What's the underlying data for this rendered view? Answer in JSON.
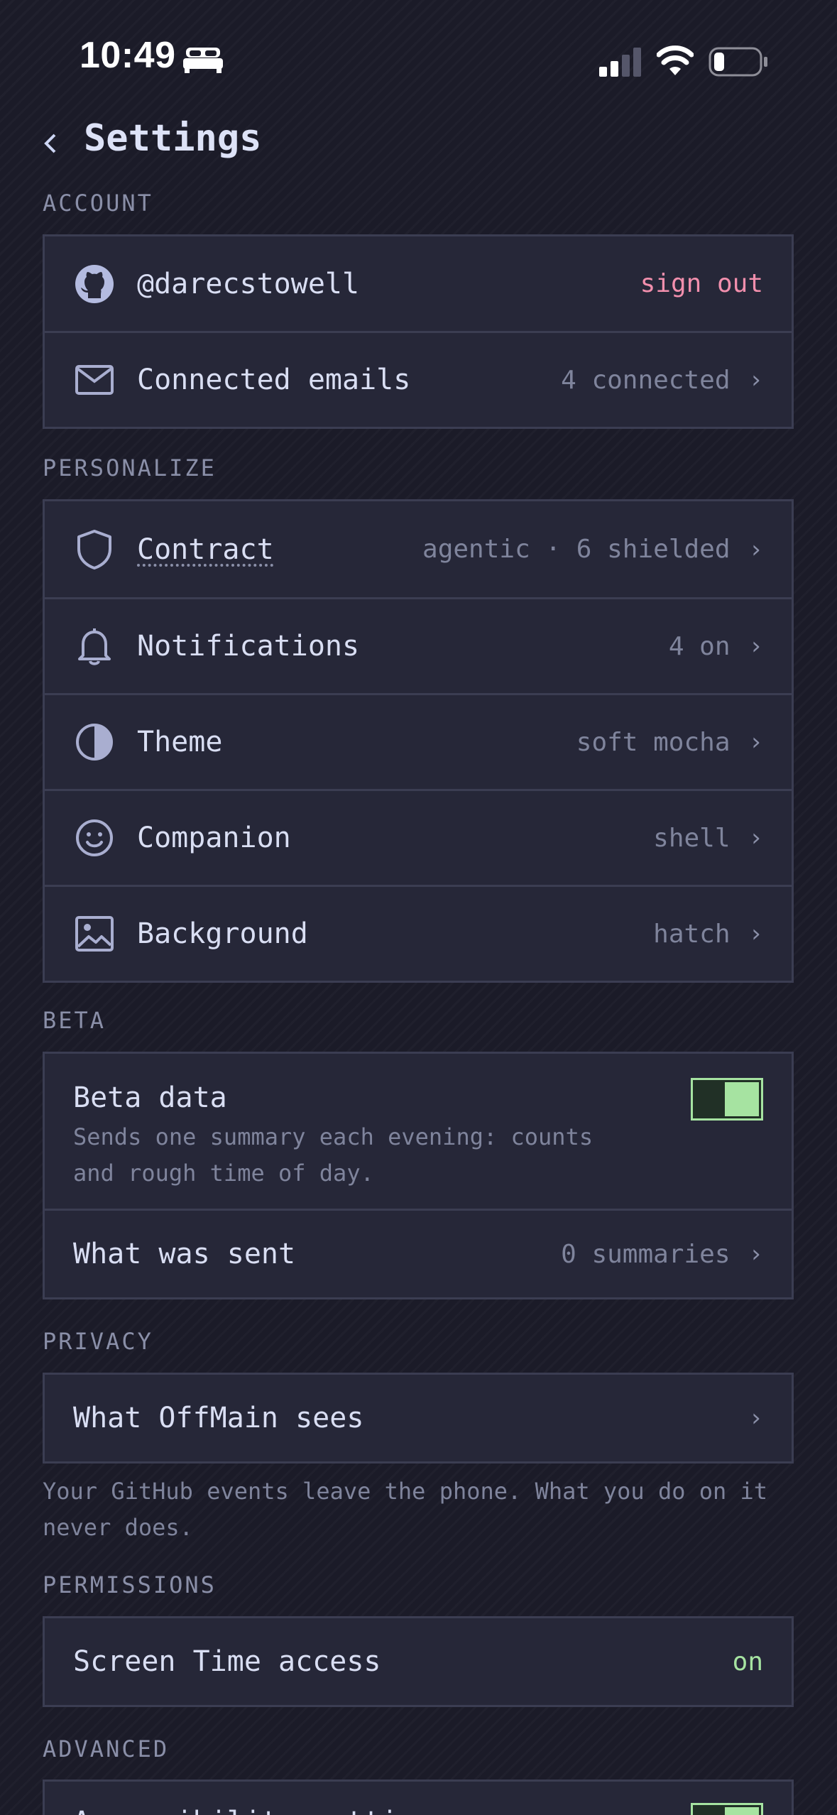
{
  "status_bar": {
    "time": "10:49"
  },
  "header": {
    "title": "Settings"
  },
  "sections": {
    "account": {
      "label": "ACCOUNT",
      "github": {
        "label": "@darecstowell",
        "action": "sign out",
        "icon": "github-icon"
      },
      "emails": {
        "label": "Connected emails",
        "value": "4 connected",
        "icon": "mail-icon"
      }
    },
    "personalize": {
      "label": "PERSONALIZE",
      "items": [
        {
          "label": "Contract",
          "value": "agentic · 6 shielded",
          "icon": "shield-icon"
        },
        {
          "label": "Notifications",
          "value": "4 on",
          "icon": "bell-icon"
        },
        {
          "label": "Theme",
          "value": "soft mocha",
          "icon": "contrast-icon"
        },
        {
          "label": "Companion",
          "value": "shell",
          "icon": "smiley-icon"
        },
        {
          "label": "Background",
          "value": "hatch",
          "icon": "image-icon"
        }
      ]
    },
    "beta": {
      "label": "BETA",
      "beta_data": {
        "label": "Beta data",
        "description": "Sends one summary each evening: counts and rough time of day.",
        "enabled": true
      },
      "what_sent": {
        "label": "What was sent",
        "value": "0 summaries"
      }
    },
    "privacy": {
      "label": "PRIVACY",
      "item": {
        "label": "What OffMain sees"
      },
      "footnote": "Your GitHub events leave the phone. What you do on it never does."
    },
    "permissions": {
      "label": "PERMISSIONS",
      "screen_time": {
        "label": "Screen Time access",
        "value": "on"
      }
    },
    "advanced": {
      "label": "ADVANCED",
      "item": {
        "label": "Accessibility settings",
        "enabled": true
      }
    }
  },
  "chevron": "›",
  "colors": {
    "background": "#1b1b28",
    "card": "#262738",
    "border": "#3b3d52",
    "text": "#d9def3",
    "muted": "#7f849c",
    "danger": "#f28fad",
    "success": "#a6e3a1"
  }
}
